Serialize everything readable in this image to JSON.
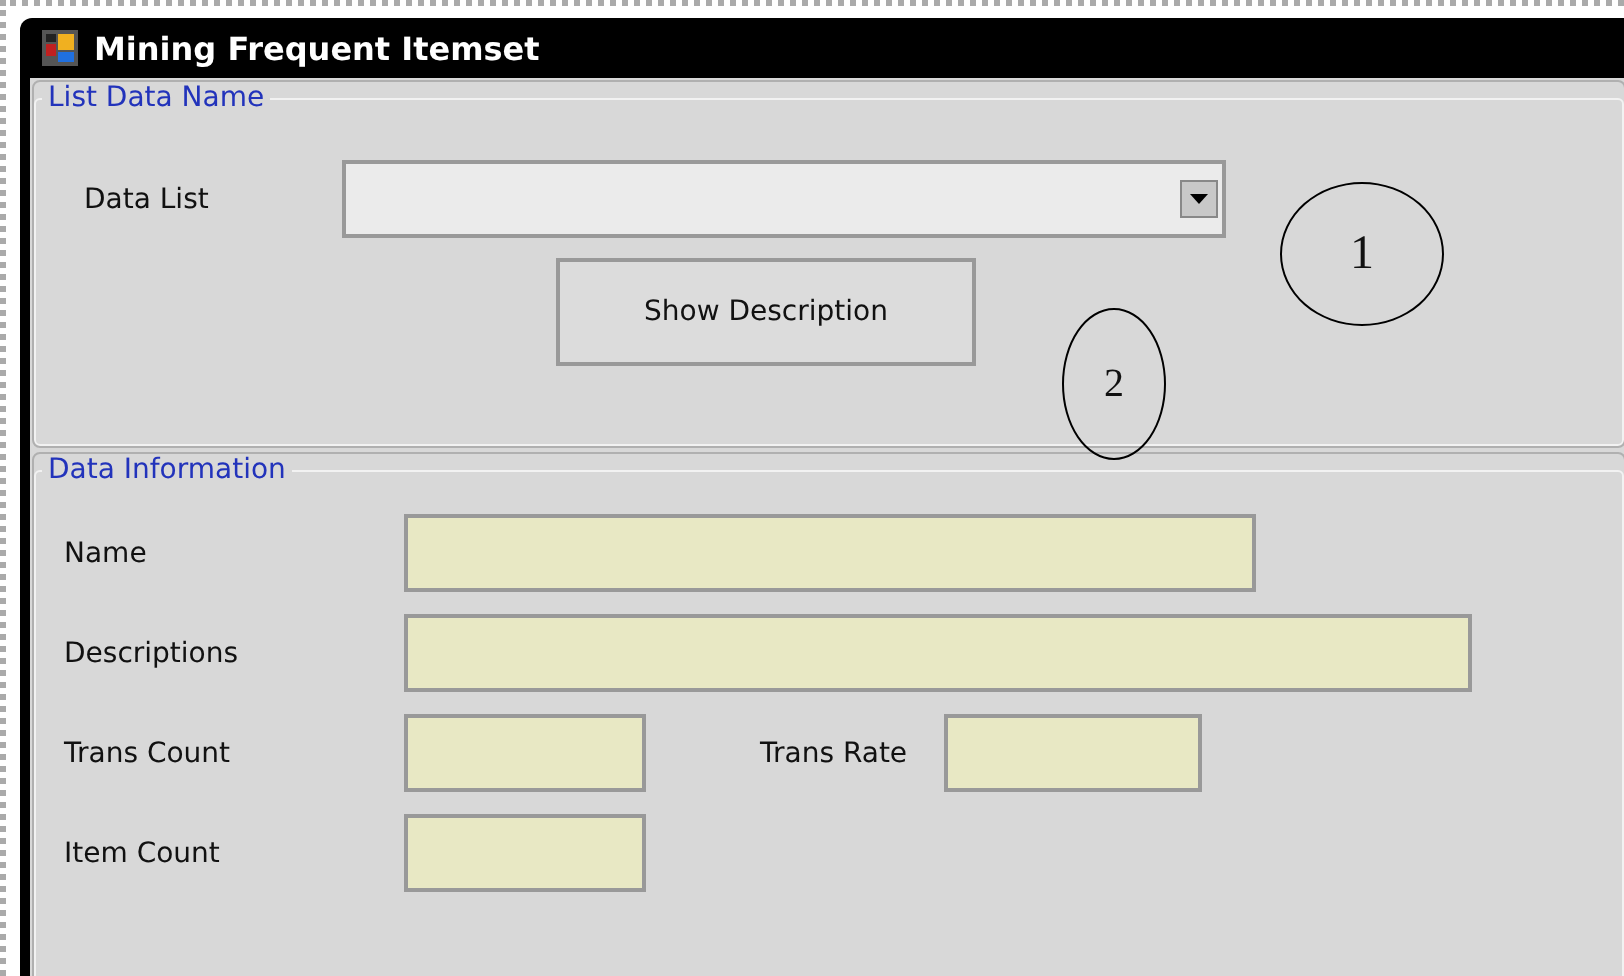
{
  "window": {
    "title": "Mining Frequent Itemset"
  },
  "list_group": {
    "title": "List Data Name",
    "data_list_label": "Data List",
    "button": "Show Description"
  },
  "info_group": {
    "title": "Data Information",
    "fields": [
      {
        "label": "Name",
        "kind": "wide"
      },
      {
        "label": "Descriptions",
        "kind": "full"
      }
    ],
    "trans_count_label": "Trans Count",
    "trans_rate_label": "Trans Rate",
    "item_count_label": "Item Count"
  },
  "annotations": [
    {
      "text": "1"
    },
    {
      "text": "2"
    }
  ]
}
